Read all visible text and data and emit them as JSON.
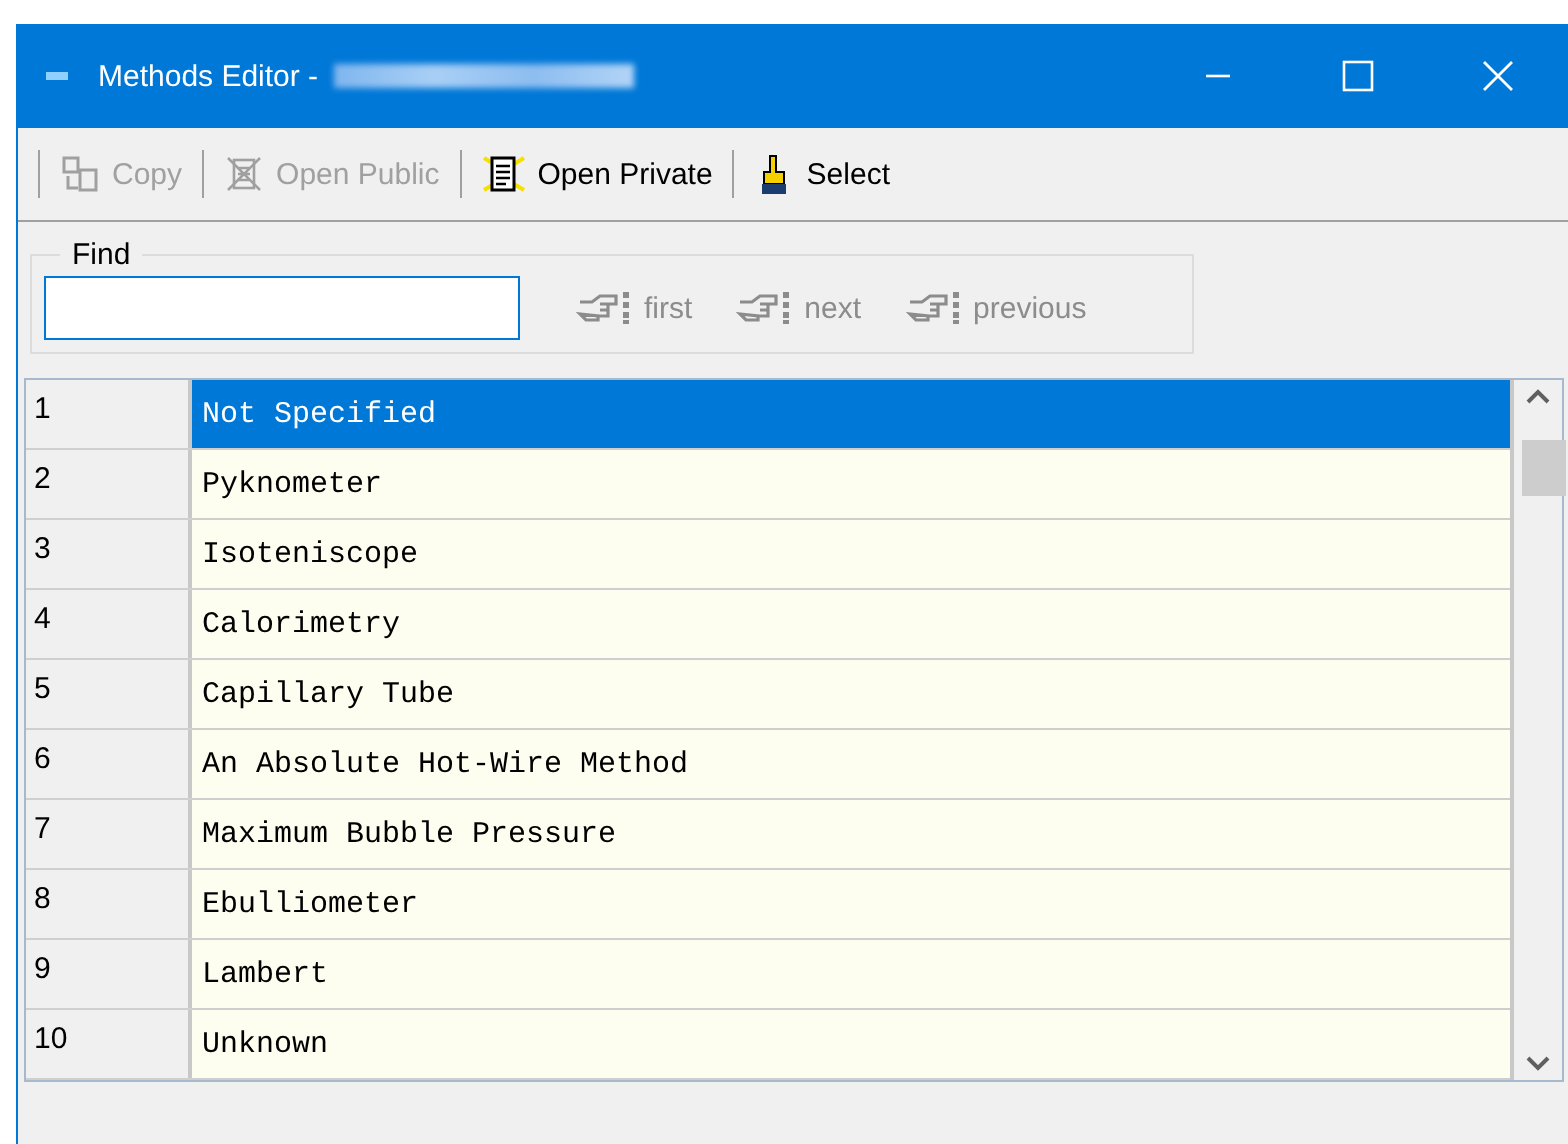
{
  "window": {
    "title": "Methods Editor -"
  },
  "toolbar": [
    {
      "label": "Copy",
      "kind": "copy",
      "disabled": true
    },
    {
      "label": "Open Public",
      "kind": "public",
      "disabled": true
    },
    {
      "label": "Open Private",
      "kind": "private",
      "disabled": false
    },
    {
      "label": "Select",
      "kind": "select",
      "disabled": false
    }
  ],
  "find": {
    "label": "Find",
    "buttons": [
      {
        "label": "first",
        "disabled": true
      },
      {
        "label": "next",
        "disabled": true
      },
      {
        "label": "previous",
        "disabled": true
      }
    ]
  },
  "table": {
    "rows": [
      {
        "number": "1",
        "method": "Not Specified",
        "selected": true
      },
      {
        "number": "2",
        "method": "Pyknometer",
        "selected": false
      },
      {
        "number": "3",
        "method": "Isoteniscope",
        "selected": false
      },
      {
        "number": "4",
        "method": "Calorimetry",
        "selected": false
      },
      {
        "number": "5",
        "method": "Capillary Tube",
        "selected": false
      },
      {
        "number": "6",
        "method": "An Absolute Hot-Wire Method",
        "selected": false
      },
      {
        "number": "7",
        "method": "Maximum Bubble Pressure",
        "selected": false
      },
      {
        "number": "8",
        "method": "Ebulliometer",
        "selected": false
      },
      {
        "number": "9",
        "method": "Lambert",
        "selected": false
      },
      {
        "number": "10",
        "method": "Unknown",
        "selected": false
      }
    ]
  }
}
